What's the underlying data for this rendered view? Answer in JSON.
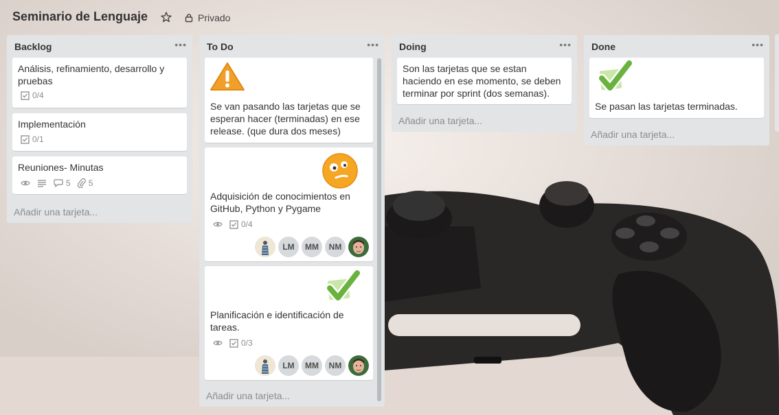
{
  "board": {
    "title": "Seminario de Lenguaje",
    "privacy": "Privado"
  },
  "lists": [
    {
      "title": "Backlog",
      "add_card": "Añadir una tarjeta...",
      "cards": [
        {
          "title": "Análisis, refinamiento, desarrollo y pruebas",
          "checklist": "0/4"
        },
        {
          "title": "Implementación",
          "checklist": "0/1"
        },
        {
          "title": "Reuniones- Minutas",
          "comments": "5",
          "attachments": "5"
        }
      ]
    },
    {
      "title": "To Do",
      "add_card": "Añadir una tarjeta...",
      "cards": [
        {
          "title": "Se van pasando las tarjetas que se esperan hacer (terminadas) en ese release. (que dura dos meses)",
          "cover": "warning-sticker"
        },
        {
          "title": "Adquisición de conocimientos en GitHub, Python y Pygame",
          "checklist": "0/4",
          "cover": "confused-face-sticker",
          "members": [
            "LM",
            "MM",
            "NM"
          ]
        },
        {
          "title": "Planificación e identificación de tareas.",
          "checklist": "0/3",
          "cover": "check-sticker",
          "members": [
            "LM",
            "MM",
            "NM"
          ]
        }
      ]
    },
    {
      "title": "Doing",
      "add_card": "Añadir una tarjeta...",
      "cards": [
        {
          "title": "Son las tarjetas que se estan haciendo en ese momento, se deben terminar por sprint (dos semanas)."
        }
      ]
    },
    {
      "title": "Done",
      "add_card": "Añadir una tarjeta...",
      "cards": [
        {
          "title": "Se pasan las tarjetas terminadas.",
          "cover": "check-sticker"
        }
      ]
    }
  ],
  "colors": {
    "list_bg": "#e2e4e6",
    "card_bg": "#ffffff",
    "text": "#333333",
    "muted": "#8c8c8c",
    "check_green": "#6ab23e",
    "warning_orange": "#f0a02a"
  }
}
